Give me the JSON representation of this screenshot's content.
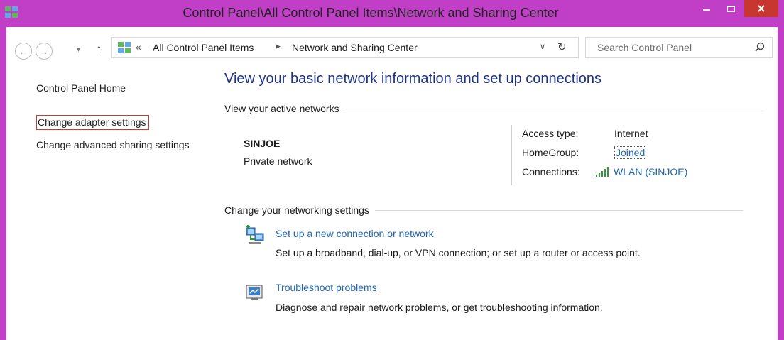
{
  "window": {
    "title": "Control Panel\\All Control Panel Items\\Network and Sharing Center",
    "accent_color": "#c13fc7",
    "close_color": "#c7372f"
  },
  "nav": {
    "back_glyph": "←",
    "forward_glyph": "→",
    "dropdown_glyph": "▾",
    "up_glyph": "↑",
    "breadcrumb_prefix": "«",
    "breadcrumb": [
      "All Control Panel Items",
      "Network and Sharing Center"
    ],
    "breadcrumb_sep": "▶",
    "search_placeholder": "Search Control Panel"
  },
  "sidebar": {
    "items": [
      {
        "label": "Control Panel Home"
      },
      {
        "label": "Change adapter settings"
      },
      {
        "label": "Change advanced sharing settings"
      }
    ]
  },
  "main": {
    "title": "View your basic network information and set up connections",
    "active_networks_header": "View your active networks",
    "network": {
      "name": "SINJOE",
      "type": "Private network",
      "access_type_label": "Access type:",
      "access_type_value": "Internet",
      "homegroup_label": "HomeGroup:",
      "homegroup_value": "Joined",
      "connections_label": "Connections:",
      "connections_value": "WLAN (SINJOE)"
    },
    "change_settings_header": "Change your networking settings",
    "tasks": [
      {
        "icon": "new-connection-icon",
        "link": "Set up a new connection or network",
        "description": "Set up a broadband, dial-up, or VPN connection; or set up a router or access point."
      },
      {
        "icon": "troubleshoot-icon",
        "link": "Troubleshoot problems",
        "description": "Diagnose and repair network problems, or get troubleshooting information."
      }
    ]
  },
  "colors": {
    "title_blue": "#1e3287",
    "link_blue": "#1f66b3",
    "highlight_red": "#d7342c"
  }
}
